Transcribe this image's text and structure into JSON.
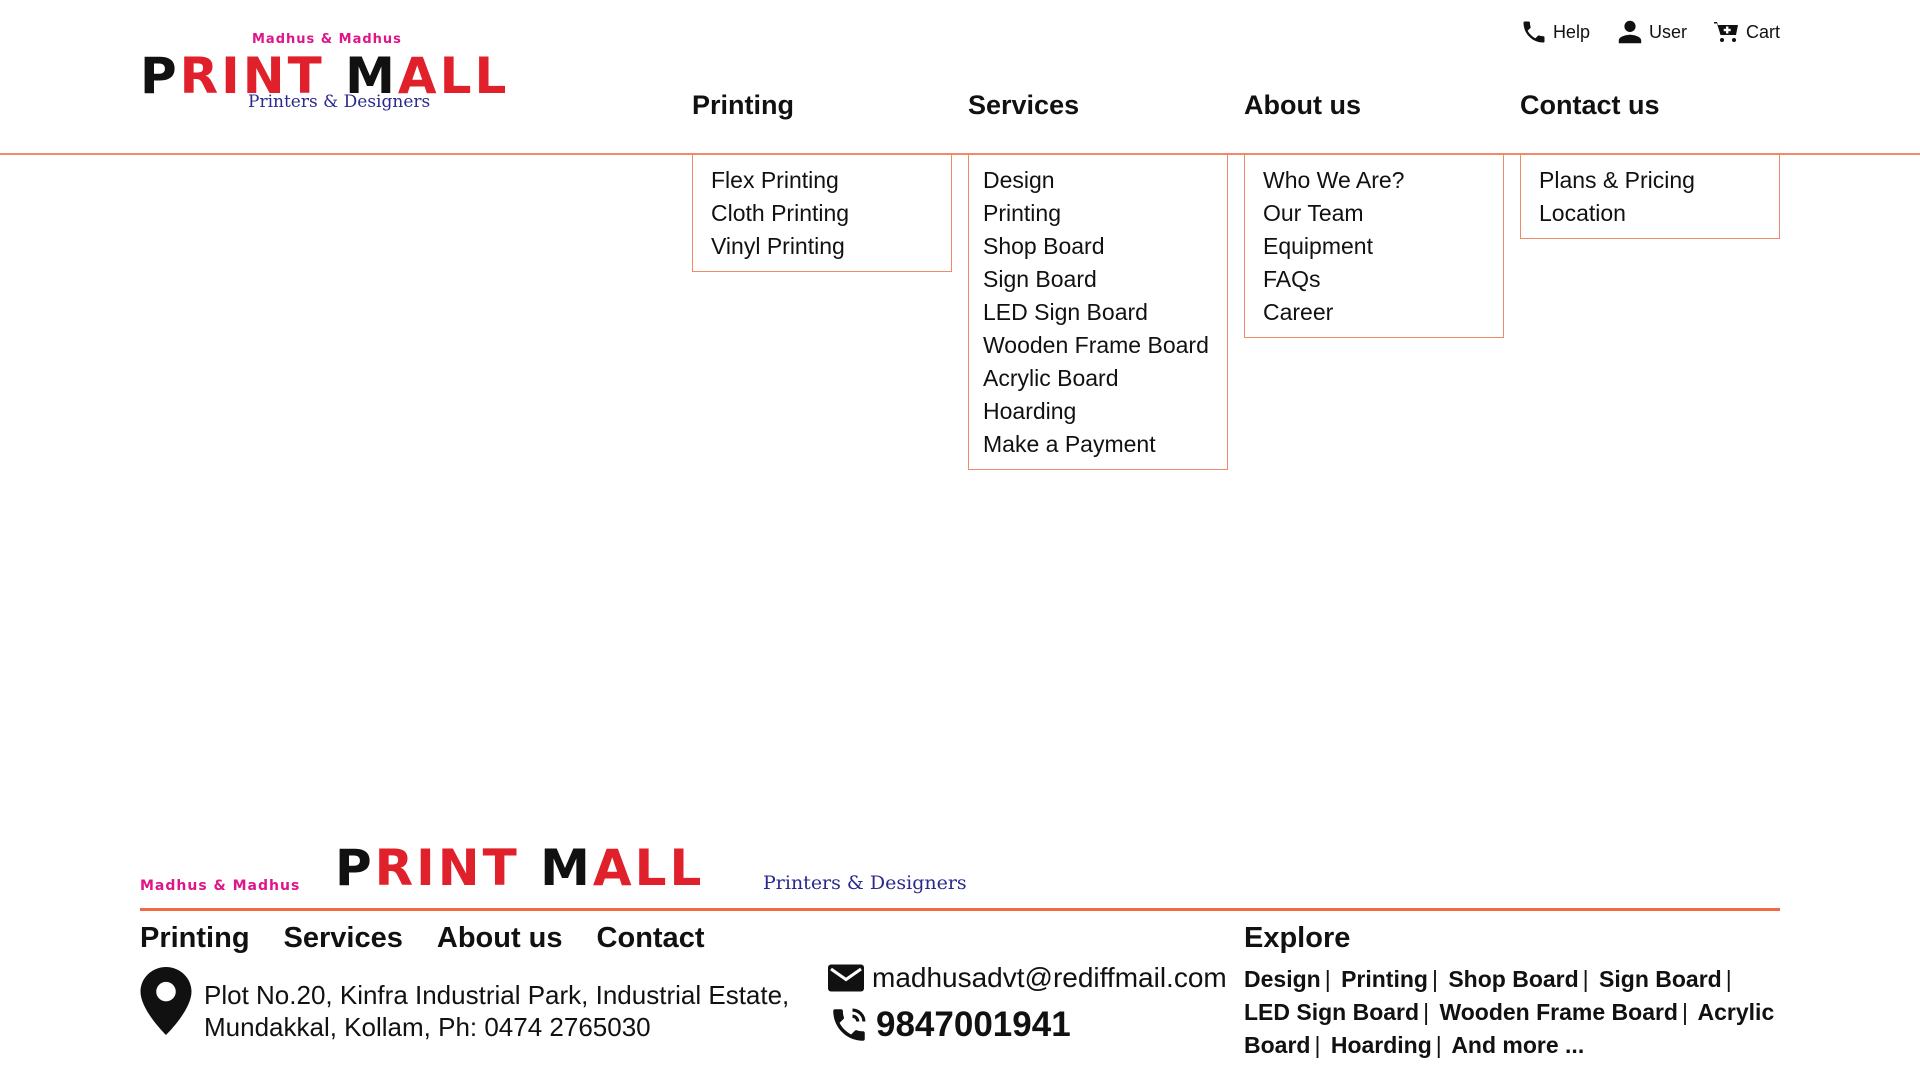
{
  "brand": {
    "top": "Madhus & Madhus",
    "name_first": "P",
    "name_second": "RINT ",
    "name_third": "M",
    "name_fourth": "ALL",
    "tagline": "Printers & Designers",
    "red": "#e0202a",
    "pink": "#e0158a",
    "navy": "#2a2a8c"
  },
  "utility": [
    {
      "label": "Help",
      "icon": "phone-icon"
    },
    {
      "label": "User",
      "icon": "user-icon"
    },
    {
      "label": "Cart",
      "icon": "cart-icon"
    }
  ],
  "nav": [
    {
      "label": "Printing",
      "items": [
        "Flex Printing",
        "Cloth Printing",
        "Vinyl Printing"
      ]
    },
    {
      "label": "Services",
      "items": [
        "Design",
        "Printing",
        "Shop Board",
        "Sign Board",
        "LED Sign Board",
        "Wooden Frame Board",
        "Acrylic Board",
        "Hoarding",
        "Make a Payment"
      ]
    },
    {
      "label": "About us",
      "items": [
        "Who We Are?",
        "Our Team",
        "Equipment",
        "FAQs",
        "Career"
      ]
    },
    {
      "label": "Contact us",
      "items": [
        "Plans & Pricing",
        "Location"
      ]
    }
  ],
  "footer": {
    "nav": [
      "Printing",
      "Services",
      "About us",
      "Contact"
    ],
    "address": "Plot No.20, Kinfra Industrial Park, Industrial Estate, Mundakkal, Kollam, Ph: 0474 2765030",
    "email": "madhusadvt@rediffmail.com",
    "phone": "9847001941",
    "explore_title": "Explore",
    "explore_links": [
      "Design",
      "Printing",
      "Shop Board",
      "Sign Board",
      "LED Sign Board",
      "Wooden Frame Board",
      "Acrylic Board",
      "Hoarding",
      "And more ..."
    ],
    "separator": "|",
    "accent": "#f26a45"
  }
}
